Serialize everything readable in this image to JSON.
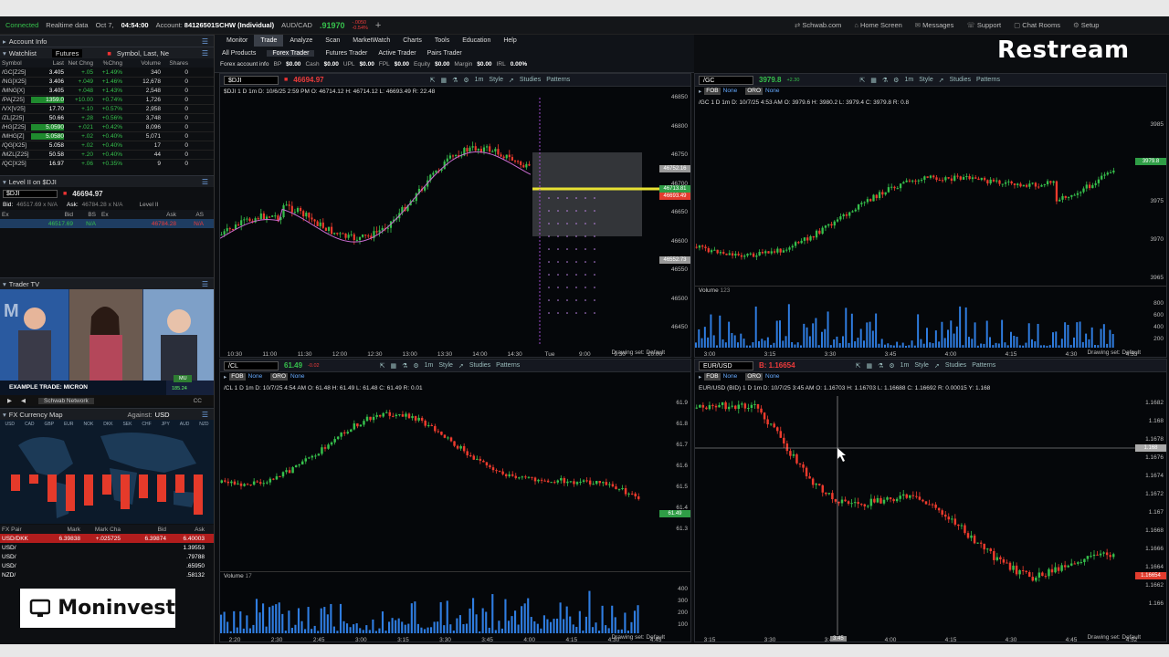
{
  "topbar": {
    "connected": "Connected",
    "realtime": "Realtime data",
    "date": "Oct 7,",
    "time": "04:54:00",
    "account_label": "Account:",
    "account": "84126501SCHW (Individual)",
    "pair": "AUD/CAD",
    "pair_price": ".91970",
    "pair_change": "-.0050",
    "pair_pct": "-0.54%"
  },
  "topnav": {
    "schwab": "Schwab.com",
    "home": "Home Screen",
    "messages": "Messages",
    "support": "Support",
    "chat": "Chat Rooms",
    "setup": "Setup",
    "ondemand": "OnDemand"
  },
  "left": {
    "account_info": "Account Info",
    "watchlist": "Watchlist",
    "watchlist_name": "Futures",
    "watch_search": "Symbol, Last, Ne",
    "cols": [
      "Symbol",
      "Last",
      "Net Chng",
      "%Chng",
      "Volume",
      "Shares"
    ],
    "rows": [
      {
        "sym": "/GC[Z25]",
        "last": "3.405",
        "net": "+.05",
        "pct": "+1.49%",
        "vol": "340",
        "shr": "0"
      },
      {
        "sym": "/NG[X25]",
        "last": "3.406",
        "net": "+.049",
        "pct": "+1.46%",
        "vol": "12,678",
        "shr": "0"
      },
      {
        "sym": "/MNG[X]",
        "last": "3.405",
        "net": "+.048",
        "pct": "+1.43%",
        "vol": "2,548",
        "shr": "0"
      },
      {
        "sym": "/PA[Z25]",
        "last": "1359.0",
        "net": "+10.00",
        "pct": "+0.74%",
        "vol": "1,726",
        "shr": "0"
      },
      {
        "sym": "/VX[V25]",
        "last": "17.70",
        "net": "+.10",
        "pct": "+0.57%",
        "vol": "2,958",
        "shr": "0"
      },
      {
        "sym": "/ZL[Z25]",
        "last": "50.66",
        "net": "+.28",
        "pct": "+0.56%",
        "vol": "3,748",
        "shr": "0"
      },
      {
        "sym": "/HG[Z25]",
        "last": "5.0590",
        "net": "+.021",
        "pct": "+0.42%",
        "vol": "8,096",
        "shr": "0"
      },
      {
        "sym": "/MHG[Z]",
        "last": "5.0580",
        "net": "+.02",
        "pct": "+0.40%",
        "vol": "5,071",
        "shr": "0"
      },
      {
        "sym": "/QG[X25]",
        "last": "5.058",
        "net": "+.02",
        "pct": "+0.40%",
        "vol": "17",
        "shr": "0"
      },
      {
        "sym": "/MZL[Z25]",
        "last": "50.58",
        "net": "+.20",
        "pct": "+0.40%",
        "vol": "44",
        "shr": "0"
      },
      {
        "sym": "/QC[X25]",
        "last": "16.97",
        "net": "+.06",
        "pct": "+0.35%",
        "vol": "9",
        "shr": "0"
      }
    ],
    "level2_title": "Level II on $DJI",
    "level2_sym": "$DJI",
    "level2_price": "46694.97",
    "bid_label": "Bid:",
    "bid_value": "46517.69 x N/A",
    "ask_label": "Ask:",
    "ask_value": "46784.28 x N/A",
    "level2_label": "Level II",
    "l2cols": [
      "Ex",
      "Bid",
      "BS",
      "Ex",
      "Ask",
      "AS"
    ],
    "l2row": {
      "bid": "46517.69",
      "bs": "N/A",
      "ask": "46784.28",
      "as": "N/A"
    },
    "trader_tv": "Trader TV",
    "tv_caption": "EXAMPLE TRADE: MICRON",
    "tv_network": "Schwab Network",
    "tv_ticker": "MU",
    "tv_price": "185.24",
    "fx_title": "FX Currency Map",
    "fx_against_label": "Against:",
    "fx_against": "USD",
    "fx_currencies": [
      "USD",
      "CAD",
      "GBP",
      "EUR",
      "NOK",
      "DKK",
      "SEK",
      "CHF",
      "JPY",
      "AUD",
      "NZD"
    ],
    "fx_cols": [
      "FX Pair",
      "Mark",
      "Mark Cha",
      "Bid",
      "Ask"
    ],
    "fx_rows": [
      {
        "pair": "USD/DKK",
        "mark": "6.39838",
        "chg": "+.025725",
        "bid": "6.39874",
        "ask": "6.40003"
      },
      {
        "pair": "USD/",
        "mark": "",
        "chg": "",
        "bid": "",
        "ask": "1.39553"
      },
      {
        "pair": "USD/",
        "mark": "",
        "chg": "",
        "bid": "",
        "ask": ".79788"
      },
      {
        "pair": "USD/",
        "mark": "",
        "chg": "",
        "bid": "",
        "ask": ".65950"
      },
      {
        "pair": "NZD/",
        "mark": "",
        "chg": "",
        "bid": "",
        "ask": ".58132"
      }
    ]
  },
  "toolbar": {
    "tabs": [
      "Monitor",
      "Trade",
      "Analyze",
      "Scan",
      "MarketWatch",
      "Charts",
      "Tools",
      "Education",
      "Help"
    ],
    "subtabs": [
      "All Products",
      "Forex Trader",
      "Futures Trader",
      "Active Trader",
      "Pairs Trader"
    ],
    "acct_title": "Forex account info",
    "bp_label": "BP",
    "bp": "$0.00",
    "cash_label": "Cash",
    "cash": "$0.00",
    "upl_label": "UPL",
    "upl": "$0.00",
    "fpl_label": "FPL",
    "fpl": "$0.00",
    "equity_label": "Equity",
    "equity": "$0.00",
    "margin_label": "Margin",
    "margin": "$0.00",
    "irl_label": "IRL",
    "irl": "0.00%"
  },
  "charts": {
    "dji": {
      "symbol": "$DJI",
      "price": "46694.97",
      "style": "Style",
      "studies": "Studies",
      "patterns": "Patterns",
      "interval": "1m",
      "info": "$DJI 1 D 1m   D: 10/6/25 2:59 PM   O: 46714.12   H: 46714.12   L: 46693.49   R: 22.48",
      "yticks": [
        "46850",
        "46800",
        "46750",
        "46700",
        "46650",
        "46600",
        "46550",
        "46500",
        "46450"
      ],
      "xticks": [
        "10:30",
        "11:00",
        "11:30",
        "12:00",
        "12:30",
        "13:00",
        "13:30",
        "14:00",
        "14:30",
        "Tue",
        "9:00",
        "9:30",
        "10:00"
      ],
      "tags": [
        "46752.16",
        "46713.81",
        "46693.49",
        "46552.73"
      ],
      "drawing": "Drawing set: Default"
    },
    "gc": {
      "symbol": "/GC",
      "price": "3979.8",
      "change": "+2.30",
      "style": "Style",
      "studies": "Studies",
      "patterns": "Patterns",
      "interval": "1m",
      "fob": "FOB",
      "none1": "None",
      "oro": "ORO",
      "none2": "None",
      "info": "/GC 1 D 1m   D: 10/7/25 4:53 AM   O: 3979.6   H: 3980.2   L: 3979.4   C: 3979.8   R: 0.8",
      "yticks": [
        "3985",
        "3980",
        "3975",
        "3970",
        "3965"
      ],
      "tag": "3979.8",
      "volume_label": "Volume",
      "volume_value": "123",
      "vticks": [
        "800",
        "600",
        "400",
        "200"
      ],
      "xticks": [
        "3:00",
        "3:15",
        "3:30",
        "3:45",
        "4:00",
        "4:15",
        "4:30",
        "4:53"
      ],
      "drawing": "Drawing set: Default"
    },
    "cl": {
      "symbol": "/CL",
      "price": "61.49",
      "change": "-0.02",
      "style": "Style",
      "studies": "Studies",
      "patterns": "Patterns",
      "interval": "1m",
      "fob": "FOB",
      "none1": "None",
      "oro": "ORO",
      "none2": "None",
      "info": "/CL 1 D 1m   D: 10/7/25 4:54 AM   O: 61.48   H: 61.49   L: 61.48   C: 61.49   R: 0.01",
      "yticks": [
        "61.9",
        "61.8",
        "61.7",
        "61.6",
        "61.5",
        "61.4",
        "61.3"
      ],
      "tag": "61.49",
      "volume_label": "Volume",
      "volume_value": "17",
      "vticks": [
        "400",
        "300",
        "200",
        "100"
      ],
      "xticks": [
        "2:20",
        "2:30",
        "2:45",
        "3:00",
        "3:15",
        "3:30",
        "3:45",
        "4:00",
        "4:15",
        "4:30",
        "4:45"
      ],
      "drawing": "Drawing set: Default"
    },
    "eur": {
      "symbol": "EUR/USD",
      "price": "B: 1.16654",
      "style": "Style",
      "studies": "Studies",
      "patterns": "Patterns",
      "interval": "1m",
      "fob": "FOB",
      "none1": "None",
      "oro": "ORO",
      "none2": "None",
      "info": "EUR/USD (BID) 1 D 1m   D: 10/7/25 3:45 AM   O: 1.16703   H: 1.16703   L: 1.16688   C: 1.16692   R: 0.00015   Y: 1.168",
      "yticks": [
        "1.1682",
        "1.168",
        "1.1678",
        "1.1676",
        "1.1674",
        "1.1672",
        "1.167",
        "1.1668",
        "1.1666",
        "1.1664",
        "1.1662",
        "1.166"
      ],
      "tag": "1.16654",
      "crosshair_tag": "1.168",
      "crosshair_x": "3:45",
      "xticks": [
        "3:15",
        "3:30",
        "3:45",
        "4:00",
        "4:15",
        "4:30",
        "4:45",
        "4:52"
      ],
      "drawing": "Drawing set: Default"
    }
  },
  "overlays": {
    "restream": "Restream",
    "moninvest": "Moninvest"
  },
  "colors": {
    "up": "#36c04c",
    "down": "#ee3b2d",
    "accent": "#2f7de1"
  }
}
